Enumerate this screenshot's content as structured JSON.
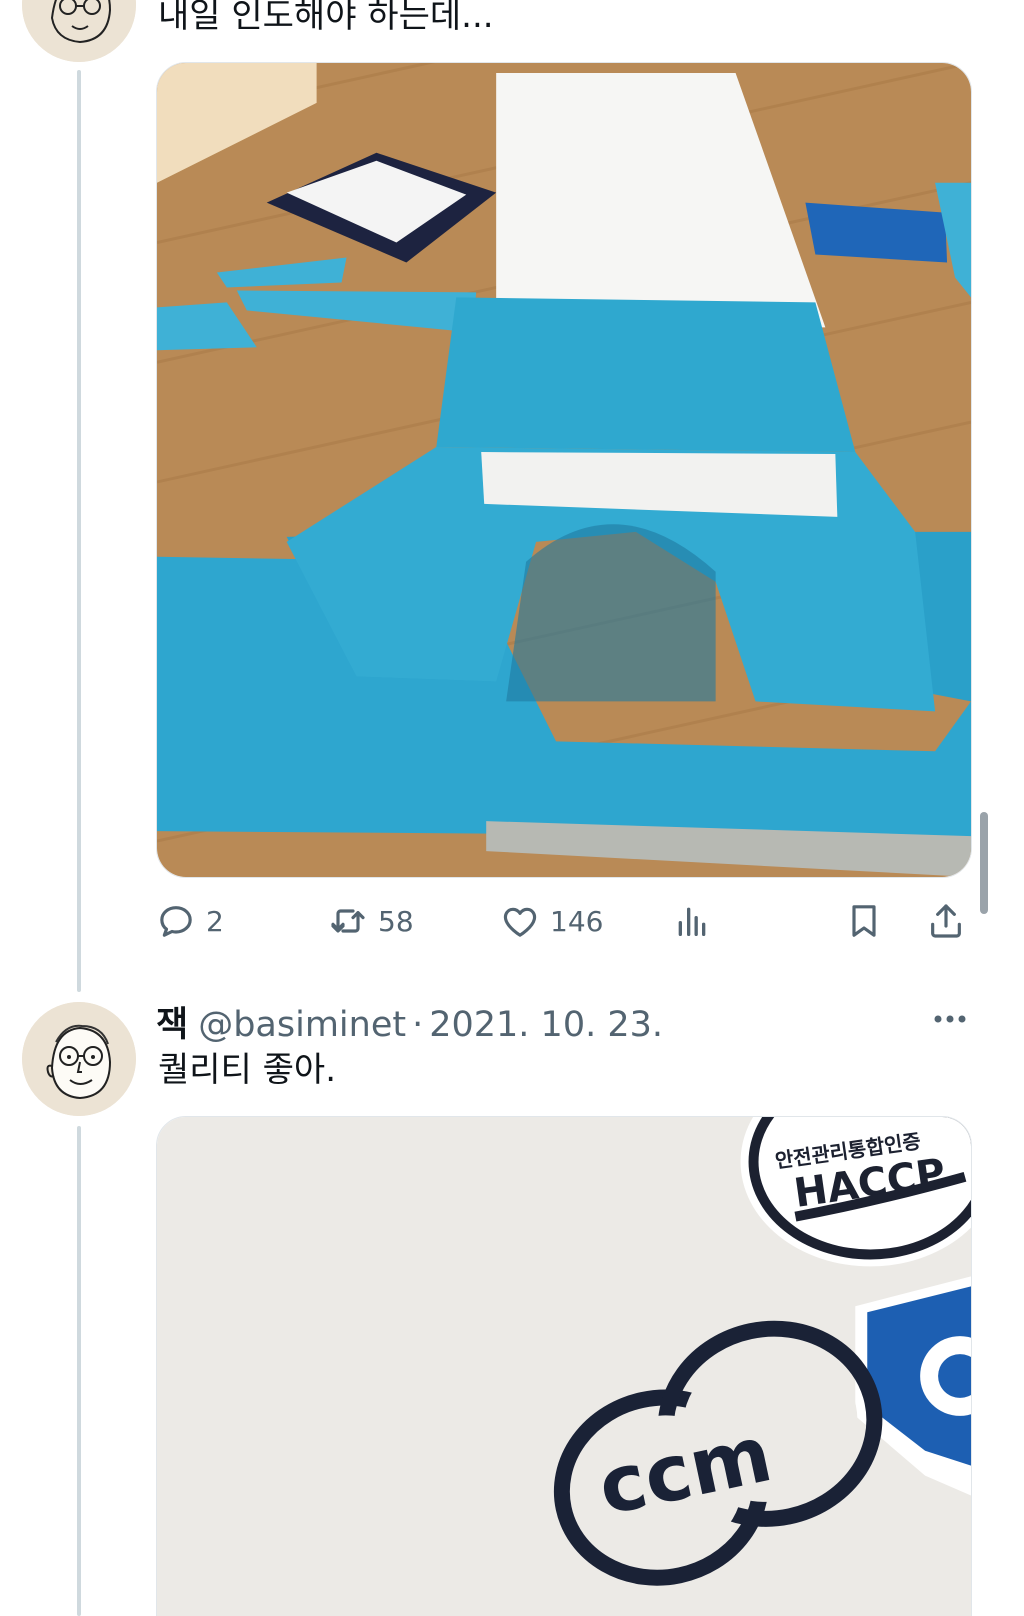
{
  "tweet1": {
    "text": "내일 인도해야 하는데...",
    "media_alt": "felt bench craft photo",
    "actions": {
      "reply": {
        "icon": "reply-icon",
        "count": "2"
      },
      "retweet": {
        "icon": "retweet-icon",
        "count": "58"
      },
      "like": {
        "icon": "heart-icon",
        "count": "146"
      },
      "views": {
        "icon": "analytics-icon"
      },
      "bookmark": {
        "icon": "bookmark-icon"
      },
      "share": {
        "icon": "share-icon"
      }
    }
  },
  "tweet2": {
    "name": "잭",
    "handle": "@basiminet",
    "separator": "·",
    "date": "2021. 10. 23.",
    "text": "퀄리티 좋아.",
    "more_icon": "more-icon",
    "media": {
      "badge_top_text": "안전관리통합인증",
      "badge_main_text": "HACCP",
      "logo_text": "ccm"
    }
  },
  "colors": {
    "text_primary": "#0f1419",
    "text_secondary": "#536471",
    "thread_line": "#cfd9de",
    "felt_blue": "#2fa8cf",
    "floor": "#b88a55"
  }
}
